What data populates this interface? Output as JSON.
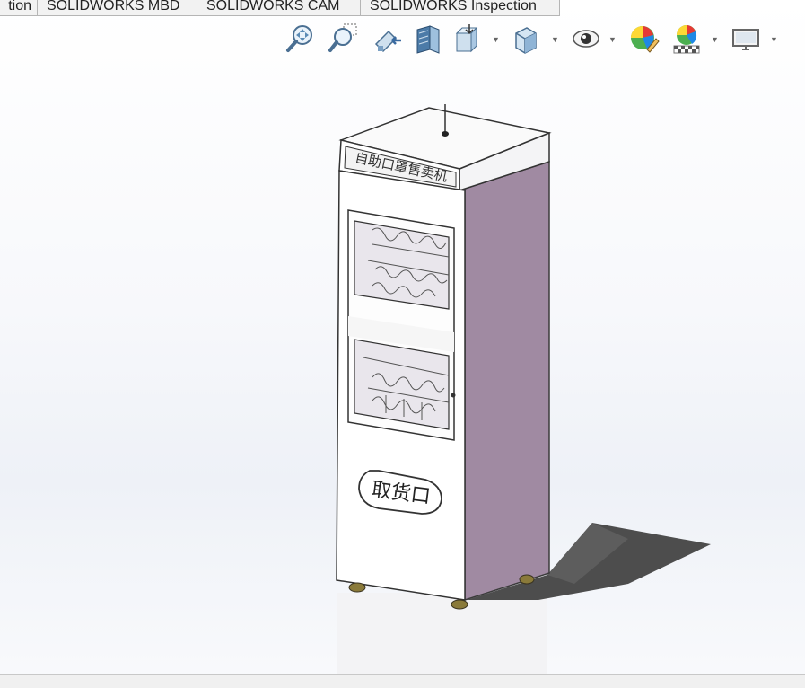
{
  "tabs": [
    {
      "label": "tion"
    },
    {
      "label": "SOLIDWORKS MBD"
    },
    {
      "label": "SOLIDWORKS CAM"
    },
    {
      "label": "SOLIDWORKS Inspection"
    }
  ],
  "toolbar": {
    "icons": [
      "zoom-to-fit-icon",
      "zoom-to-area-icon",
      "previous-view-icon",
      "section-view-icon",
      "view-orientation-icon",
      "display-style-icon",
      "hide-show-items-icon",
      "edit-appearance-icon",
      "apply-scene-icon",
      "view-settings-icon"
    ]
  },
  "model": {
    "sign_text": "自助口罩售卖机",
    "pickup_label": "取货口"
  },
  "colors": {
    "cabinet_side": "#a08aa2",
    "cabinet_front": "#ffffff",
    "shadow": "#505050",
    "background_top": "#ffffff",
    "background_bottom": "#eef1f7"
  }
}
